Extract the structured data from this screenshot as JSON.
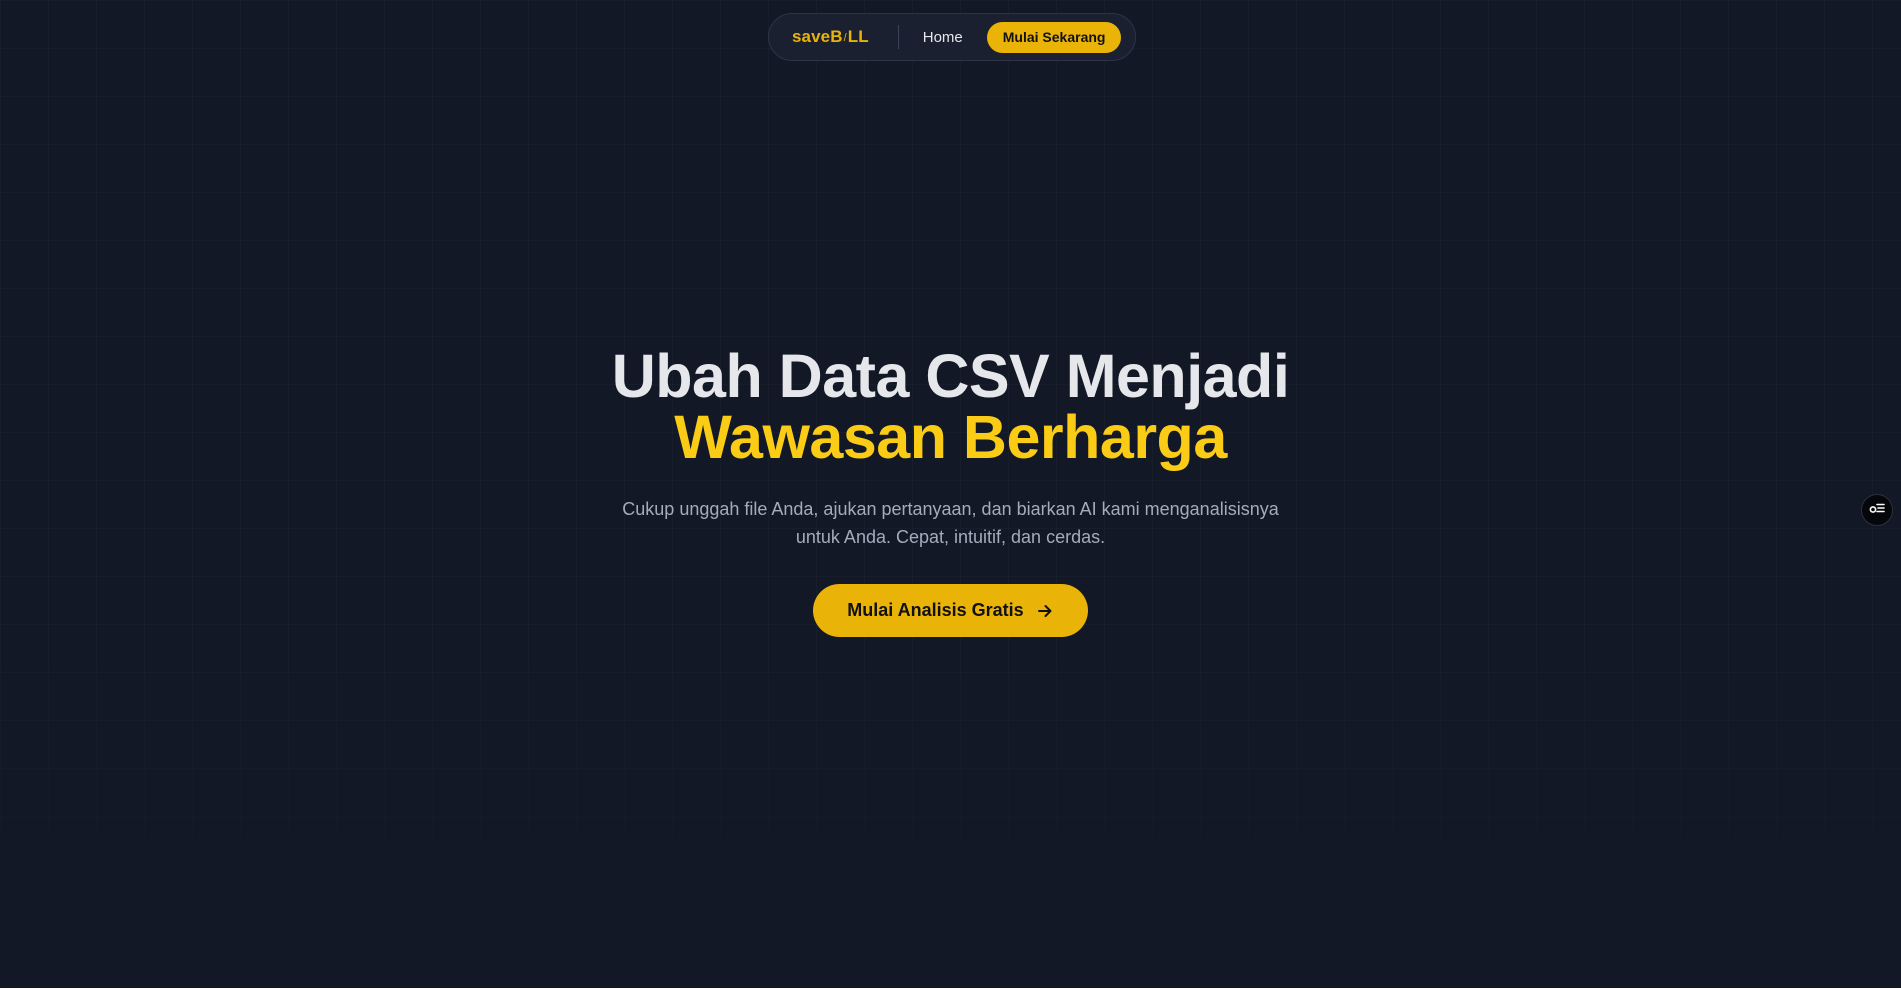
{
  "colors": {
    "background": "#121826",
    "accent": "#eab308",
    "headline_highlight": "#facc15",
    "headline_text": "#e5e7eb",
    "body_text": "#a3acbb"
  },
  "nav": {
    "logo_part1": "saveB",
    "logo_part2": "/",
    "logo_part3": "LL",
    "home_label": "Home",
    "cta_label": "Mulai Sekarang"
  },
  "hero": {
    "title_line1": "Ubah Data CSV Menjadi",
    "title_line2": "Wawasan Berharga",
    "subtitle": "Cukup unggah file Anda, ajukan pertanyaan, dan biarkan AI kami menganalisisnya untuk Anda. Cepat, intuitif, dan cerdas.",
    "cta_label": "Mulai Analisis Gratis",
    "cta_icon": "arrow-right-icon"
  },
  "side_widget": {
    "icon": "settings-toggle-icon"
  }
}
